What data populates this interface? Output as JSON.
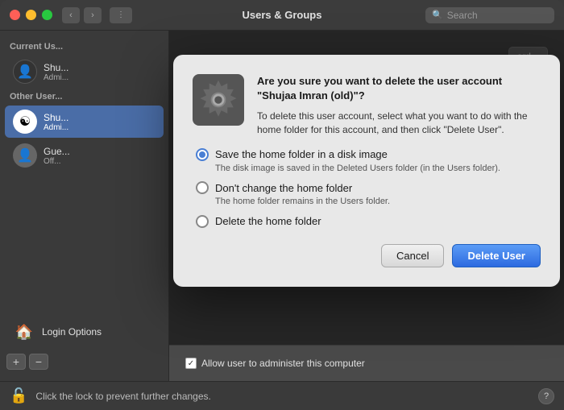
{
  "titleBar": {
    "title": "Users & Groups",
    "searchPlaceholder": "Search",
    "trafficLights": [
      "close",
      "minimize",
      "maximize"
    ]
  },
  "sidebar": {
    "currentUserLabel": "Current Us...",
    "otherUsersLabel": "Other User...",
    "currentUser": {
      "name": "Shu...",
      "role": "Admi..."
    },
    "otherUsers": [
      {
        "name": "Shu...",
        "role": "Admi...",
        "selected": true
      },
      {
        "name": "Gue...",
        "role": "Off..."
      }
    ],
    "loginOptions": "Login Options",
    "plusLabel": "+",
    "minusLabel": "−"
  },
  "mainPanel": {
    "passwordButton": "ord...",
    "checkbox": {
      "label": "Allow user to administer this computer",
      "checked": true
    }
  },
  "dialog": {
    "title": "Are you sure you want to delete the user account \"Shujaa Imran (old)\"?",
    "subtitle": "To delete this user account, select what you want to do with the home folder for this account, and then click \"Delete User\".",
    "options": [
      {
        "label": "Save the home folder in a disk image",
        "description": "The disk image is saved in the Deleted Users folder (in the Users folder).",
        "selected": true
      },
      {
        "label": "Don't change the home folder",
        "description": "The home folder remains in the Users folder.",
        "selected": false
      },
      {
        "label": "Delete the home folder",
        "description": "",
        "selected": false
      }
    ],
    "cancelButton": "Cancel",
    "deleteButton": "Delete User"
  },
  "bottomBar": {
    "lockText": "Click the lock to prevent further changes.",
    "helpLabel": "?"
  }
}
